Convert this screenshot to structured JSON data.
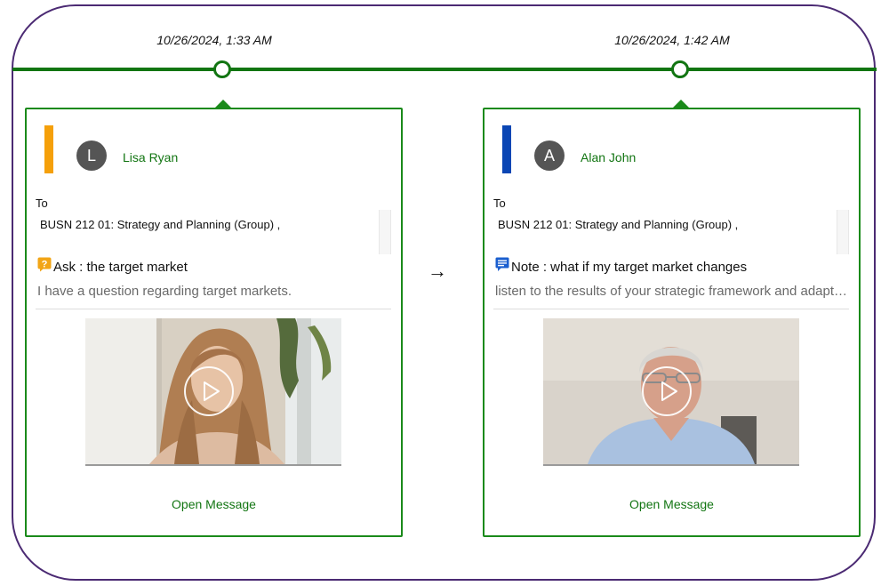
{
  "colors": {
    "frame_border": "#4b2a73",
    "timeline": "#127512",
    "card_border": "#1a8a1a",
    "link_text": "#127512"
  },
  "connector_icon": "right-arrow-icon",
  "events": [
    {
      "timestamp": "10/26/2024, 1:33 AM",
      "accent_color": "#f5a00a",
      "avatar_initial": "L",
      "sender": "Lisa Ryan",
      "to_label": "To",
      "recipients": "BUSN 212 01: Strategy and Planning (Group) ,",
      "type_icon": "question-icon",
      "type_label": "Ask",
      "subject": "Ask : the target market",
      "preview": "I have a question regarding target markets.",
      "video_thumbnail": "woman-video-thumbnail",
      "play_icon": "play-icon",
      "open_label": "Open Message"
    },
    {
      "timestamp": "10/26/2024, 1:42 AM",
      "accent_color": "#0a46b4",
      "avatar_initial": "A",
      "sender": "Alan John",
      "to_label": "To",
      "recipients": "BUSN 212 01: Strategy and Planning (Group) ,",
      "type_icon": "note-icon",
      "type_label": "Note",
      "subject": "Note : what if my target market changes",
      "preview": "listen to the results of your strategic framework and adapt accordingly",
      "video_thumbnail": "man-video-thumbnail",
      "play_icon": "play-icon",
      "open_label": "Open Message"
    }
  ]
}
